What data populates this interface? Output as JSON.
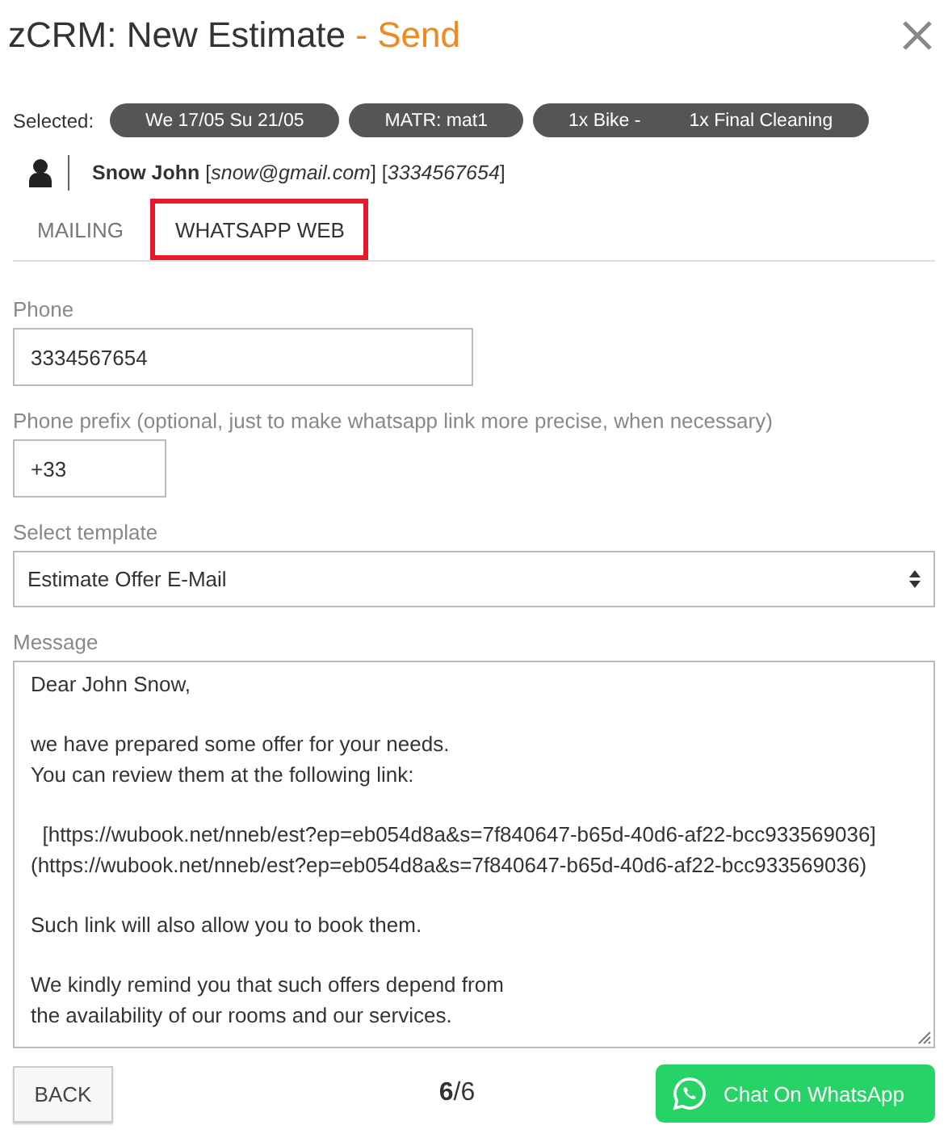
{
  "title": {
    "main": "zCRM: New Estimate",
    "accent": "- Send"
  },
  "selected": {
    "label": "Selected:",
    "chips": [
      {
        "parts": [
          "We 17/05 Su 21/05"
        ]
      },
      {
        "parts": [
          "MATR: mat1"
        ]
      },
      {
        "parts": [
          "1x Bike -",
          "1x Final Cleaning"
        ]
      }
    ]
  },
  "customer": {
    "info": "**Snow John** [*snow@gmail.com*] [*3334567654*]"
  },
  "tabs": [
    {
      "label": "MAILING",
      "selected": false
    },
    {
      "label": "WHATSAPP WEB",
      "selected": true
    }
  ],
  "phone": {
    "label": "Phone",
    "value": "3334567654"
  },
  "prefix": {
    "label": "Phone prefix (optional, just to make whatsapp link more precise, when necessary)",
    "value": "+33"
  },
  "template": {
    "label": "Select template",
    "value": "Estimate Offer E-Mail"
  },
  "message": {
    "label": "Message",
    "paragraphs": [
      [
        "Dear John Snow,"
      ],
      [
        "we have prepared some offer for your needs.",
        "You can review them at the following link:"
      ],
      [
        "  [https://wubook.net/nneb/est?ep=eb054d8a&s=7f840647-b65d-40d6-af22-bcc933569036]",
        "(https://wubook.net/nneb/est?ep=eb054d8a&s=7f840647-b65d-40d6-af22-bcc933569036)"
      ],
      [
        "Such link will also allow you to book them."
      ],
      [
        "We kindly remind you that such offers depend from",
        "the availability of our rooms and our services."
      ]
    ]
  },
  "footer": {
    "back": "BACK",
    "page": "**6**/6",
    "send": "Chat On WhatsApp"
  }
}
